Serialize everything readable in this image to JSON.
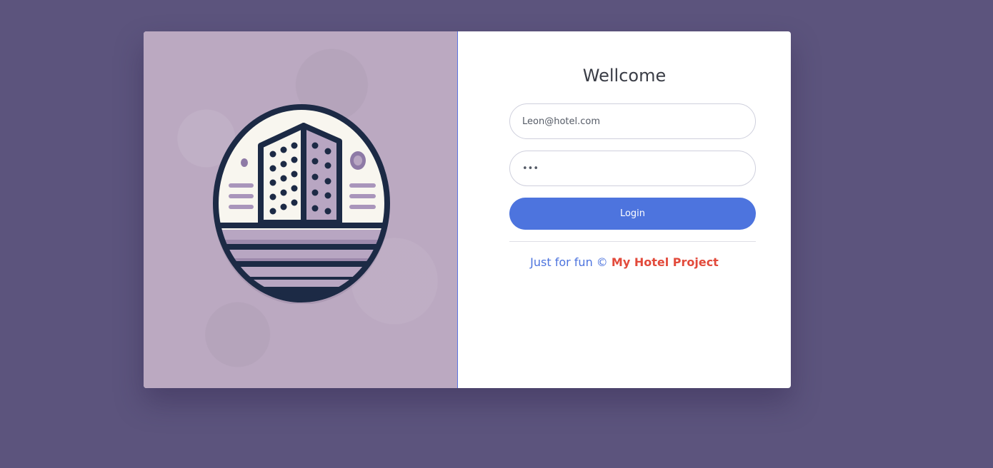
{
  "login": {
    "title": "Wellcome",
    "email_value": "Leon@hotel.com",
    "password_value": "•••",
    "button_label": "Login"
  },
  "footer": {
    "prefix": "Just for fun ©",
    "brand": "My Hotel Project"
  },
  "colors": {
    "page_background": "#5c547d",
    "left_panel": "#bba9c1",
    "accent": "#4d74de",
    "brand": "#e24a3b"
  },
  "icons": {
    "logo": "hotel-building-icon"
  }
}
